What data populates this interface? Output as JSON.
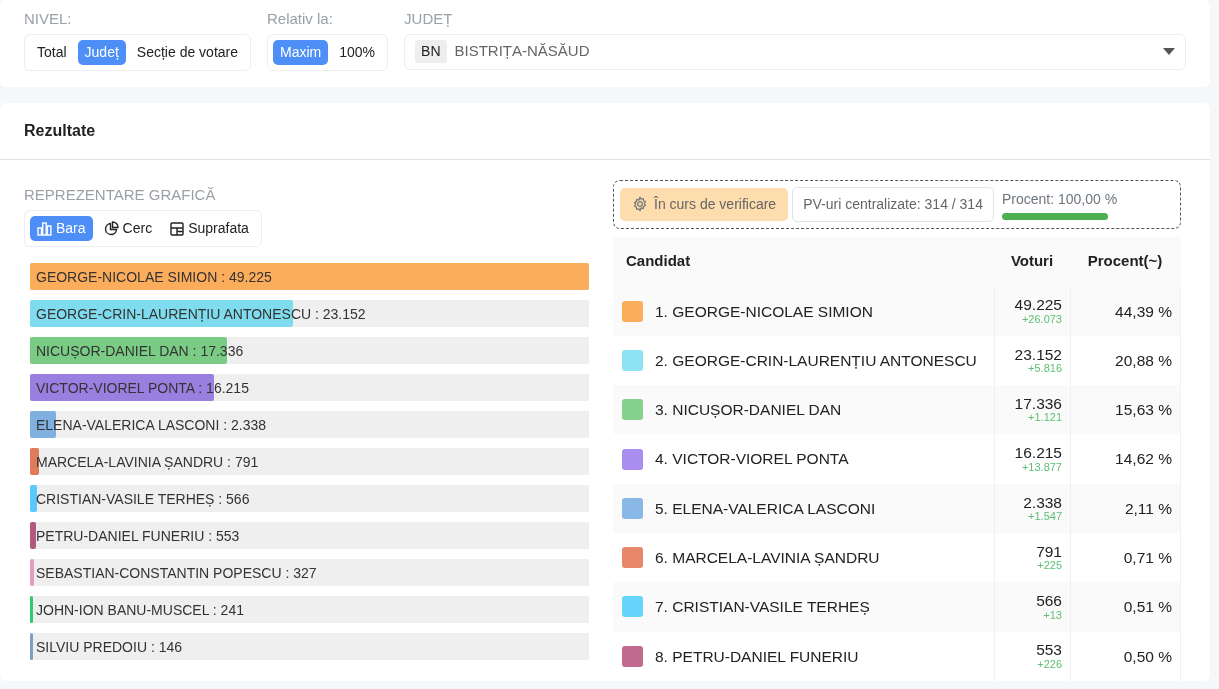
{
  "filters": [
    {
      "label": "NIVEL:",
      "kind": "segmented",
      "options": [
        {
          "label": "Total",
          "selected": false
        },
        {
          "label": "Județ",
          "selected": true
        },
        {
          "label": "Secție de votare",
          "selected": false
        }
      ]
    },
    {
      "label": "Relativ la:",
      "kind": "segmented",
      "options": [
        {
          "label": "Maxim",
          "selected": true
        },
        {
          "label": "100%",
          "selected": false
        }
      ]
    },
    {
      "label": "JUDEȚ",
      "kind": "select",
      "code": "BN",
      "value": "BISTRIȚA-NĂSĂUD"
    }
  ],
  "results": {
    "title": "Rezultate",
    "chart_section": {
      "title": "REPREZENTARE GRAFICĂ",
      "views": [
        {
          "label": "Bara",
          "kind": "bar",
          "selected": true
        },
        {
          "label": "Cerc",
          "kind": "pie",
          "selected": false
        },
        {
          "label": "Suprafata",
          "kind": "area",
          "selected": false
        }
      ],
      "bars": [
        {
          "label": "GEORGE-NICOLAE SIMION : 49.225",
          "level": 1,
          "color": "#fbad5c"
        },
        {
          "label": "GEORGE-CRIN-LAURENȚIU ANTONESCU : 23.152",
          "level": 0.47,
          "color": "#7fdcee"
        },
        {
          "label": "NICUȘOR-DANIEL DAN : 17.336",
          "level": 0.352,
          "color": "#7acc85"
        },
        {
          "label": "VICTOR-VIOREL PONTA : 16.215",
          "level": 0.329,
          "color": "#9b7fe0"
        },
        {
          "label": "ELENA-VALERICA LASCONI : 2.338",
          "level": 0.047,
          "color": "#7fb0e0"
        },
        {
          "label": "MARCELA-LAVINIA ȘANDRU : 791",
          "level": 0.016,
          "color": "#e07b5a"
        },
        {
          "label": "CRISTIAN-VASILE TERHEȘ : 566",
          "level": 0.012,
          "color": "#5ac8fa"
        },
        {
          "label": "PETRU-DANIEL FUNERIU : 553",
          "level": 0.011,
          "color": "#b05a80"
        },
        {
          "label": "SEBASTIAN-CONSTANTIN POPESCU : 327",
          "level": 0.007,
          "color": "#e99ac0"
        },
        {
          "label": "JOHN-ION BANU-MUSCEL : 241",
          "level": 0.005,
          "color": "#2ecc71"
        },
        {
          "label": "SILVIU PREDOIU : 146",
          "level": 0.003,
          "color": "#7f9fc0"
        }
      ]
    },
    "status": {
      "badge": "În curs de verificare",
      "counted": "PV-uri centralizate: 314 / 314",
      "percent_label": "Procent: 100,00 %",
      "level": 1
    },
    "table": {
      "columns": [
        "Candidat",
        "Voturi",
        "Procent(~)"
      ],
      "rows": [
        {
          "candidate": "1. GEORGE-NICOLAE SIMION",
          "color": "#fbad5c",
          "votes": "49.225",
          "delta": "+26.073",
          "percent": "44,39 %"
        },
        {
          "candidate": "2. GEORGE-CRIN-LAURENȚIU ANTONESCU",
          "color": "#8ee3f2",
          "votes": "23.152",
          "delta": "+5.816",
          "percent": "20,88 %"
        },
        {
          "candidate": "3. NICUȘOR-DANIEL DAN",
          "color": "#85d18e",
          "votes": "17.336",
          "delta": "+1.121",
          "percent": "15,63 %"
        },
        {
          "candidate": "4. VICTOR-VIOREL PONTA",
          "color": "#a98ef0",
          "votes": "16.215",
          "delta": "+13.877",
          "percent": "14,62 %"
        },
        {
          "candidate": "5. ELENA-VALERICA LASCONI",
          "color": "#8ab8e6",
          "votes": "2.338",
          "delta": "+1.547",
          "percent": "2,11 %"
        },
        {
          "candidate": "6. MARCELA-LAVINIA ȘANDRU",
          "color": "#e6876a",
          "votes": "791",
          "delta": "+225",
          "percent": "0,71 %"
        },
        {
          "candidate": "7. CRISTIAN-VASILE TERHEȘ",
          "color": "#66d4fb",
          "votes": "566",
          "delta": "+13",
          "percent": "0,51 %"
        },
        {
          "candidate": "8. PETRU-DANIEL FUNERIU",
          "color": "#c06a8e",
          "votes": "553",
          "delta": "+226",
          "percent": "0,50 %"
        }
      ]
    }
  }
}
